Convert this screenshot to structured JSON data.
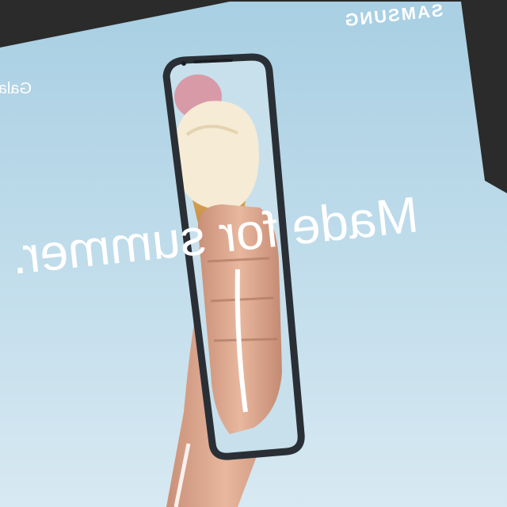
{
  "brand": "SAMSUNG",
  "product_partial": "Gala",
  "headline": "Made for summer.",
  "colors": {
    "background": "#2b2b2b",
    "sky_top": "#a9cfe2",
    "sky_bottom": "#d9e9f1",
    "text": "#ffffff",
    "phone_frame": "#2a2f36"
  },
  "icons": [
    "ice-cream-cone",
    "phone-outline"
  ]
}
